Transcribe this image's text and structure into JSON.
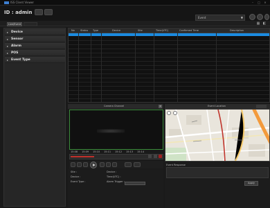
{
  "titlebar": {
    "title": "ISS Client Viewer",
    "min": "–",
    "max": "□",
    "close": "✕"
  },
  "account": {
    "user_id": "ID : admin",
    "site_value": "Event"
  },
  "tabs": [
    {
      "label": "Live/Event"
    }
  ],
  "tree": [
    {
      "label": "Device"
    },
    {
      "label": "Sensor"
    },
    {
      "label": "Alarm"
    },
    {
      "label": "POS"
    },
    {
      "label": "Event Type"
    }
  ],
  "table": {
    "columns": [
      "No",
      "Status",
      "Type",
      "Device",
      "Site",
      "Time(UTC)",
      "Confirmed Time",
      "Description"
    ]
  },
  "video": {
    "title": "Camera Channel",
    "close": "x",
    "timeline_labels": [
      "15:08",
      "15:09",
      "15:10",
      "15:11",
      "15:12",
      "15:13",
      "15:14"
    ]
  },
  "info": {
    "labels": [
      "Site :",
      "Device :",
      "Event Type :",
      "Device :",
      "Time(UTC) :",
      "Alarm Trigger :"
    ]
  },
  "map": {
    "title": "Event Location"
  },
  "note": {
    "label": "Event Response",
    "button": "Apply"
  }
}
